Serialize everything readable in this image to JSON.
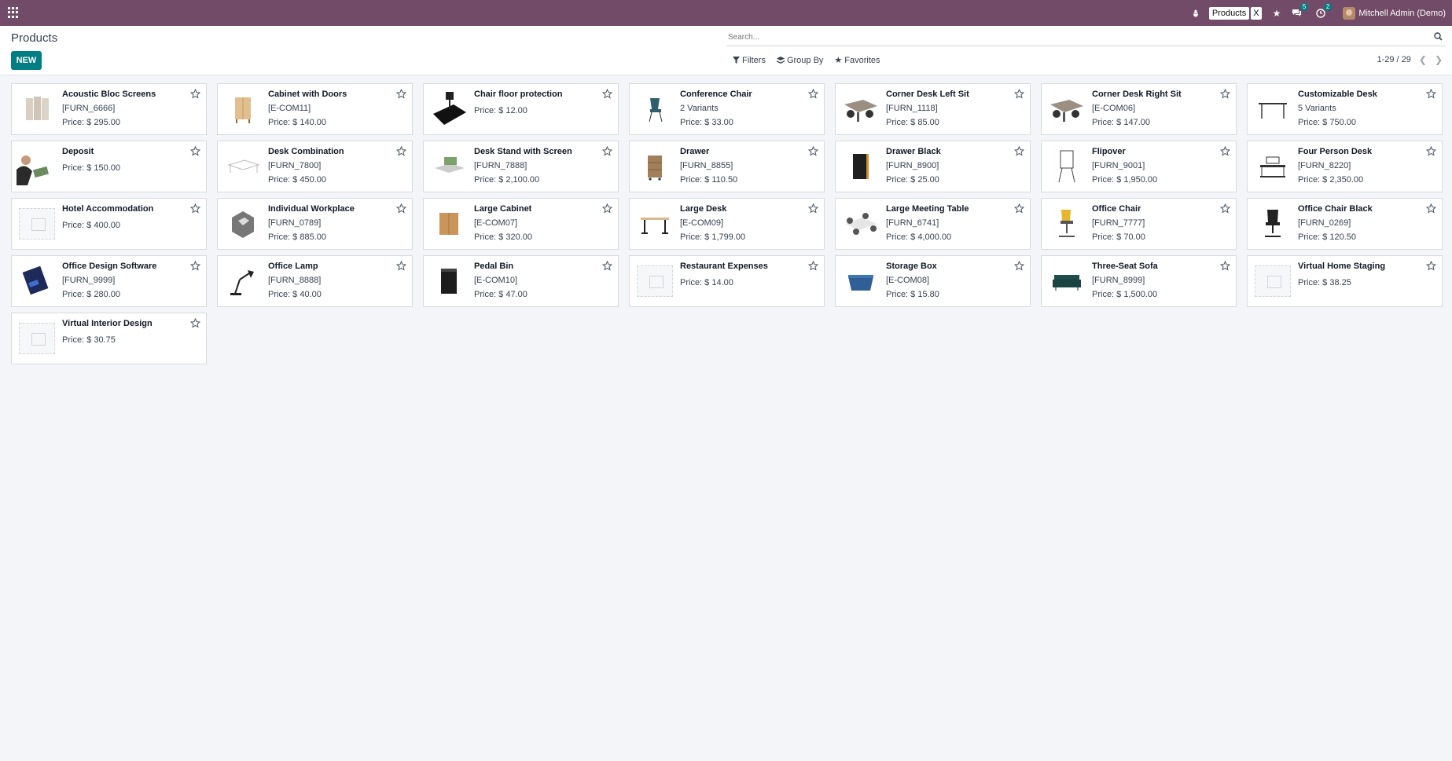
{
  "navbar": {
    "products_label": "Products",
    "close_label": "X",
    "chat_count": "5",
    "activity_count": "2",
    "user": "Mitchell Admin (Demo)"
  },
  "control": {
    "title": "Products",
    "new_label": "NEW",
    "search_placeholder": "Search...",
    "filters_label": "Filters",
    "groupby_label": "Group By",
    "favorites_label": "Favorites",
    "pager": "1-29 / 29"
  },
  "products": [
    {
      "name": "Acoustic Bloc Screens",
      "ref": "[FURN_6666]",
      "price": "Price: $ 295.00",
      "icon": "acoustic-screen"
    },
    {
      "name": "Cabinet with Doors",
      "ref": "[E-COM11]",
      "price": "Price: $ 140.00",
      "icon": "cabinet"
    },
    {
      "name": "Chair floor protection",
      "ref": "",
      "price": "Price: $ 12.00",
      "icon": "floor-mat"
    },
    {
      "name": "Conference Chair",
      "ref": "2 Variants",
      "price": "Price: $ 33.00",
      "icon": "chair"
    },
    {
      "name": "Corner Desk Left Sit",
      "ref": "[FURN_1118]",
      "price": "Price: $ 85.00",
      "icon": "corner-desk"
    },
    {
      "name": "Corner Desk Right Sit",
      "ref": "[E-COM06]",
      "price": "Price: $ 147.00",
      "icon": "corner-desk"
    },
    {
      "name": "Customizable Desk",
      "ref": "5 Variants",
      "price": "Price: $ 750.00",
      "icon": "desk"
    },
    {
      "name": "Deposit",
      "ref": "",
      "price": "Price: $ 150.00",
      "icon": "deposit"
    },
    {
      "name": "Desk Combination",
      "ref": "[FURN_7800]",
      "price": "Price: $ 450.00",
      "icon": "desk-combination"
    },
    {
      "name": "Desk Stand with Screen",
      "ref": "[FURN_7888]",
      "price": "Price: $ 2,100.00",
      "icon": "desk-screen"
    },
    {
      "name": "Drawer",
      "ref": "[FURN_8855]",
      "price": "Price: $ 110.50",
      "icon": "drawer"
    },
    {
      "name": "Drawer Black",
      "ref": "[FURN_8900]",
      "price": "Price: $ 25.00",
      "icon": "drawer-black"
    },
    {
      "name": "Flipover",
      "ref": "[FURN_9001]",
      "price": "Price: $ 1,950.00",
      "icon": "flipover"
    },
    {
      "name": "Four Person Desk",
      "ref": "[FURN_8220]",
      "price": "Price: $ 2,350.00",
      "icon": "four-desk"
    },
    {
      "name": "Hotel Accommodation",
      "ref": "",
      "price": "Price: $ 400.00",
      "icon": "placeholder"
    },
    {
      "name": "Individual Workplace",
      "ref": "[FURN_0789]",
      "price": "Price: $ 885.00",
      "icon": "workplace"
    },
    {
      "name": "Large Cabinet",
      "ref": "[E-COM07]",
      "price": "Price: $ 320.00",
      "icon": "large-cabinet"
    },
    {
      "name": "Large Desk",
      "ref": "[E-COM09]",
      "price": "Price: $ 1,799.00",
      "icon": "large-desk"
    },
    {
      "name": "Large Meeting Table",
      "ref": "[FURN_6741]",
      "price": "Price: $ 4,000.00",
      "icon": "meeting-table"
    },
    {
      "name": "Office Chair",
      "ref": "[FURN_7777]",
      "price": "Price: $ 70.00",
      "icon": "office-chair"
    },
    {
      "name": "Office Chair Black",
      "ref": "[FURN_0269]",
      "price": "Price: $ 120.50",
      "icon": "office-chair-black"
    },
    {
      "name": "Office Design Software",
      "ref": "[FURN_9999]",
      "price": "Price: $ 280.00",
      "icon": "software"
    },
    {
      "name": "Office Lamp",
      "ref": "[FURN_8888]",
      "price": "Price: $ 40.00",
      "icon": "lamp"
    },
    {
      "name": "Pedal Bin",
      "ref": "[E-COM10]",
      "price": "Price: $ 47.00",
      "icon": "bin"
    },
    {
      "name": "Restaurant Expenses",
      "ref": "",
      "price": "Price: $ 14.00",
      "icon": "placeholder"
    },
    {
      "name": "Storage Box",
      "ref": "[E-COM08]",
      "price": "Price: $ 15.80",
      "icon": "storage-box"
    },
    {
      "name": "Three-Seat Sofa",
      "ref": "[FURN_8999]",
      "price": "Price: $ 1,500.00",
      "icon": "sofa"
    },
    {
      "name": "Virtual Home Staging",
      "ref": "",
      "price": "Price: $ 38.25",
      "icon": "placeholder"
    },
    {
      "name": "Virtual Interior Design",
      "ref": "",
      "price": "Price: $ 30.75",
      "icon": "placeholder"
    }
  ],
  "colors": {
    "navbar": "#714b67",
    "primary": "#017e84",
    "background": "#f4f5f8"
  }
}
